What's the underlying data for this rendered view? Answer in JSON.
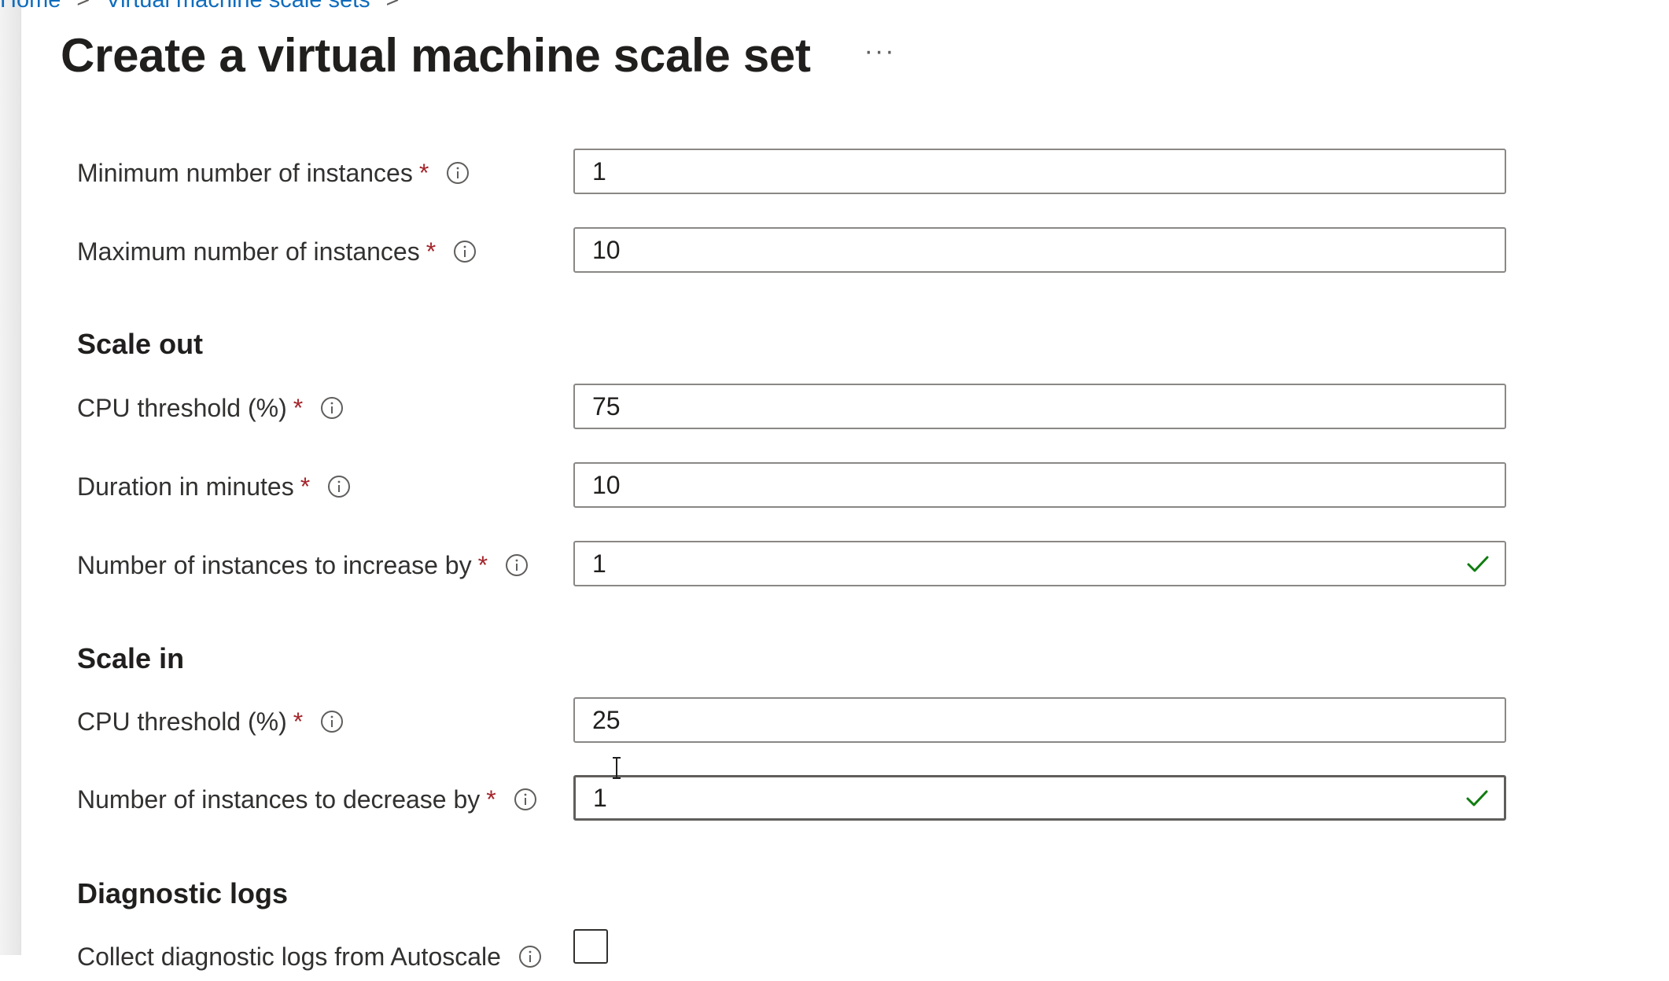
{
  "breadcrumb": {
    "home": "Home",
    "vmss": "Virtual machine scale sets"
  },
  "header": {
    "title": "Create a virtual machine scale set",
    "more": "···"
  },
  "fields": {
    "min_instances": {
      "label": "Minimum number of instances",
      "required": "*",
      "value": "1"
    },
    "max_instances": {
      "label": "Maximum number of instances",
      "required": "*",
      "value": "10"
    },
    "scale_out_cpu": {
      "label": "CPU threshold (%)",
      "required": "*",
      "value": "75"
    },
    "scale_out_duration": {
      "label": "Duration in minutes",
      "required": "*",
      "value": "10"
    },
    "scale_out_increase": {
      "label": "Number of instances to increase by",
      "required": "*",
      "value": "1"
    },
    "scale_in_cpu": {
      "label": "CPU threshold (%)",
      "required": "*",
      "value": "25"
    },
    "scale_in_decrease": {
      "label": "Number of instances to decrease by",
      "required": "*",
      "value": "1"
    }
  },
  "sections": {
    "scale_out": "Scale out",
    "scale_in": "Scale in",
    "diagnostic_logs": "Diagnostic logs"
  },
  "diagnostics": {
    "collect_label": "Collect diagnostic logs from Autoscale",
    "checked": false
  },
  "colors": {
    "accent": "#0f6cbd",
    "required": "#a4262c",
    "valid": "#107c10"
  }
}
